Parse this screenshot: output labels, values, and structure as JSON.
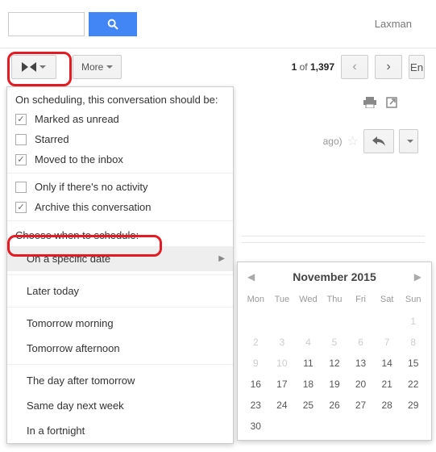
{
  "user": "Laxman",
  "toolbar": {
    "more_label": "More",
    "en_label": "En"
  },
  "pager": {
    "pos": "1",
    "of_label": "of",
    "total": "1,397"
  },
  "conv": {
    "time_suffix": "ago)"
  },
  "menu": {
    "heading": "On scheduling, this conversation should be:",
    "opts": [
      {
        "label": "Marked as unread",
        "checked": true
      },
      {
        "label": "Starred",
        "checked": false
      },
      {
        "label": "Moved to the inbox",
        "checked": true
      }
    ],
    "conds": [
      {
        "label": "Only if there's no activity",
        "checked": false
      },
      {
        "label": "Archive this conversation",
        "checked": true
      }
    ],
    "choose_label": "Choose when to schedule:",
    "schedule": [
      "On a specific date",
      "Later today",
      "Tomorrow morning",
      "Tomorrow afternoon",
      "The day after tomorrow",
      "Same day next week",
      "In a fortnight"
    ]
  },
  "calendar": {
    "title": "November 2015",
    "dow": [
      "Mon",
      "Tue",
      "Wed",
      "Thu",
      "Fri",
      "Sat",
      "Sun"
    ],
    "cells": [
      {
        "d": "",
        "dim": true
      },
      {
        "d": "",
        "dim": true
      },
      {
        "d": "",
        "dim": true
      },
      {
        "d": "",
        "dim": true
      },
      {
        "d": "",
        "dim": true
      },
      {
        "d": "",
        "dim": true
      },
      {
        "d": "1",
        "dim": true
      },
      {
        "d": "2",
        "dim": true
      },
      {
        "d": "3",
        "dim": true
      },
      {
        "d": "4",
        "dim": true
      },
      {
        "d": "5",
        "dim": true
      },
      {
        "d": "6",
        "dim": true
      },
      {
        "d": "7",
        "dim": true
      },
      {
        "d": "8",
        "dim": true
      },
      {
        "d": "9",
        "dim": true
      },
      {
        "d": "10",
        "dim": true
      },
      {
        "d": "11",
        "dim": false
      },
      {
        "d": "12",
        "dim": false
      },
      {
        "d": "13",
        "dim": false
      },
      {
        "d": "14",
        "dim": false
      },
      {
        "d": "15",
        "dim": false
      },
      {
        "d": "16",
        "dim": false
      },
      {
        "d": "17",
        "dim": false
      },
      {
        "d": "18",
        "dim": false
      },
      {
        "d": "19",
        "dim": false
      },
      {
        "d": "20",
        "dim": false
      },
      {
        "d": "21",
        "dim": false
      },
      {
        "d": "22",
        "dim": false
      },
      {
        "d": "23",
        "dim": false
      },
      {
        "d": "24",
        "dim": false
      },
      {
        "d": "25",
        "dim": false
      },
      {
        "d": "26",
        "dim": false
      },
      {
        "d": "27",
        "dim": false
      },
      {
        "d": "28",
        "dim": false
      },
      {
        "d": "29",
        "dim": false
      },
      {
        "d": "30",
        "dim": false
      },
      {
        "d": "",
        "dim": true
      },
      {
        "d": "",
        "dim": true
      },
      {
        "d": "",
        "dim": true
      },
      {
        "d": "",
        "dim": true
      },
      {
        "d": "",
        "dim": true
      },
      {
        "d": "",
        "dim": true
      }
    ]
  }
}
